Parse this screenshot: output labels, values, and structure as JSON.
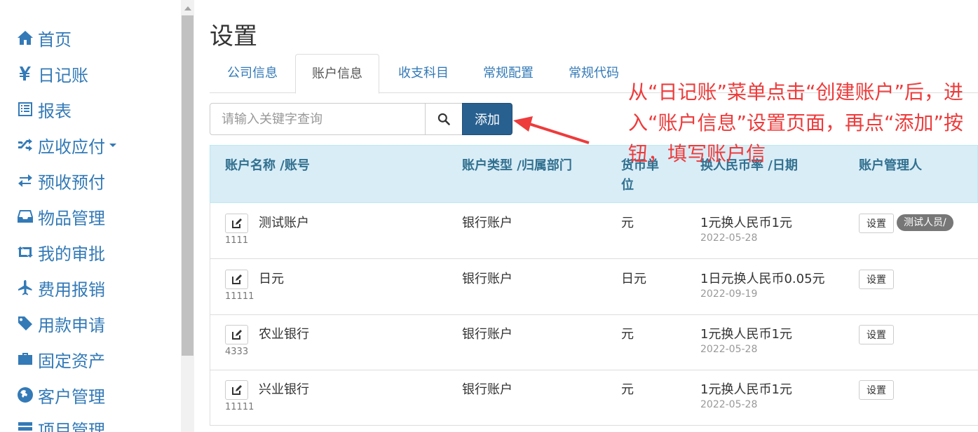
{
  "sidebar": {
    "items": [
      {
        "label": "首页",
        "icon": "home-icon"
      },
      {
        "label": "日记账",
        "icon": "yen-icon"
      },
      {
        "label": "报表",
        "icon": "list-icon"
      },
      {
        "label": "应收应付",
        "icon": "shuffle-icon"
      },
      {
        "label": "预收预付",
        "icon": "transfer-icon"
      },
      {
        "label": "物品管理",
        "icon": "inbox-icon"
      },
      {
        "label": "我的审批",
        "icon": "retweet-icon"
      },
      {
        "label": "费用报销",
        "icon": "plane-icon"
      },
      {
        "label": "用款申请",
        "icon": "tag-icon"
      },
      {
        "label": "固定资产",
        "icon": "briefcase-icon"
      },
      {
        "label": "客户管理",
        "icon": "globe-icon"
      },
      {
        "label": "项目管理",
        "icon": "tasks-icon"
      }
    ]
  },
  "page": {
    "title": "设置"
  },
  "tabs": [
    {
      "label": "公司信息"
    },
    {
      "label": "账户信息"
    },
    {
      "label": "收支科目"
    },
    {
      "label": "常规配置"
    },
    {
      "label": "常规代码"
    }
  ],
  "search": {
    "placeholder": "请输入关键字查询",
    "value": ""
  },
  "toolbar": {
    "add_label": "添加"
  },
  "table": {
    "headers": {
      "name": "账户名称 /账号",
      "type": "账户类型 /归属部门",
      "currency_l1": "货币单",
      "currency_l2": "位",
      "rate": "换人民币率 /日期",
      "manager": "账户管理人"
    },
    "rows": [
      {
        "name": "测试账户",
        "number": "1111",
        "type": "银行账户",
        "currency": "元",
        "rate": "1元换人民币1元",
        "date": "2022-05-28",
        "settings": "设置",
        "manager": "测试人员/"
      },
      {
        "name": "日元",
        "number": "11111",
        "type": "银行账户",
        "currency": "日元",
        "rate": "1日元换人民币0.05元",
        "date": "2022-09-19",
        "settings": "设置",
        "manager": ""
      },
      {
        "name": "农业银行",
        "number": "4333",
        "type": "银行账户",
        "currency": "元",
        "rate": "1元换人民币1元",
        "date": "2022-05-28",
        "settings": "设置",
        "manager": ""
      },
      {
        "name": "兴业银行",
        "number": "11111",
        "type": "银行账户",
        "currency": "元",
        "rate": "1元换人民币1元",
        "date": "2022-05-28",
        "settings": "设置",
        "manager": ""
      }
    ]
  },
  "annotation": {
    "text": "从“日记账”菜单点击“创建账户”后，进入“账户信息”设置页面，再点“添加”按钮，填写账户信"
  },
  "colors": {
    "link": "#337ab7",
    "primary": "#286090",
    "annotation": "#ee3b3b",
    "table_head": "#d9edf7"
  }
}
